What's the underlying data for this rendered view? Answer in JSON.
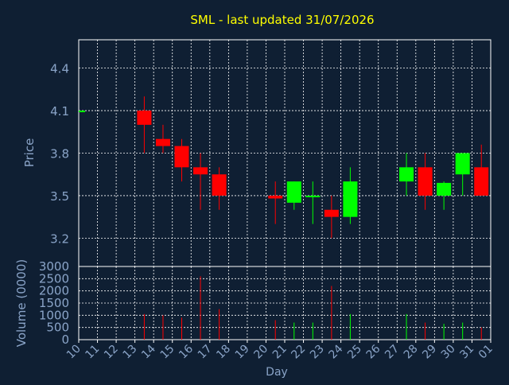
{
  "colors": {
    "background": "#0f1f33",
    "title": "#ffff00",
    "axis_text": "#8aa4c8",
    "grid": "#ffffff",
    "up": "#00ff00",
    "down": "#ff0000"
  },
  "chart_data": [
    {
      "type": "candlestick",
      "title": "SML - last updated 31/07/2026",
      "ylabel": "Price",
      "ylim": [
        3.0,
        4.6
      ],
      "yticks": [
        3.2,
        3.5,
        3.8,
        4.1,
        4.4
      ],
      "ytick_labels": [
        "3.2",
        "3.5",
        "3.8",
        "4.1",
        "4.4"
      ],
      "grid": true,
      "candles": [
        {
          "x": "10",
          "open": 4.1,
          "high": 4.1,
          "low": 4.1,
          "close": 4.1
        },
        {
          "x": "13",
          "open": 4.1,
          "high": 4.2,
          "low": 3.8,
          "close": 4.0
        },
        {
          "x": "14",
          "open": 3.9,
          "high": 4.0,
          "low": 3.8,
          "close": 3.85
        },
        {
          "x": "15",
          "open": 3.85,
          "high": 3.9,
          "low": 3.6,
          "close": 3.7
        },
        {
          "x": "16",
          "open": 3.7,
          "high": 3.8,
          "low": 3.4,
          "close": 3.65
        },
        {
          "x": "17",
          "open": 3.65,
          "high": 3.7,
          "low": 3.4,
          "close": 3.5
        },
        {
          "x": "20",
          "open": 3.5,
          "high": 3.6,
          "low": 3.3,
          "close": 3.48
        },
        {
          "x": "21",
          "open": 3.45,
          "high": 3.6,
          "low": 3.4,
          "close": 3.6
        },
        {
          "x": "22",
          "open": 3.49,
          "high": 3.6,
          "low": 3.3,
          "close": 3.5
        },
        {
          "x": "23",
          "open": 3.4,
          "high": 3.5,
          "low": 3.2,
          "close": 3.35
        },
        {
          "x": "24",
          "open": 3.35,
          "high": 3.7,
          "low": 3.3,
          "close": 3.6
        },
        {
          "x": "27",
          "open": 3.6,
          "high": 3.8,
          "low": 3.5,
          "close": 3.7
        },
        {
          "x": "28",
          "open": 3.7,
          "high": 3.8,
          "low": 3.4,
          "close": 3.5
        },
        {
          "x": "29",
          "open": 3.5,
          "high": 3.6,
          "low": 3.4,
          "close": 3.59
        },
        {
          "x": "30",
          "open": 3.65,
          "high": 3.8,
          "low": 3.5,
          "close": 3.8
        },
        {
          "x": "31",
          "open": 3.7,
          "high": 3.86,
          "low": 3.5,
          "close": 3.5
        }
      ]
    },
    {
      "type": "bar",
      "ylabel": "Volume (0000)",
      "xlabel": "Day",
      "ylim": [
        0,
        3000
      ],
      "yticks": [
        0,
        500,
        1000,
        1500,
        2000,
        2500,
        3000
      ],
      "ytick_labels": [
        "0",
        "500",
        "1000",
        "1500",
        "2000",
        "2500",
        "3000"
      ],
      "categories": [
        "10",
        "11",
        "12",
        "13",
        "14",
        "15",
        "16",
        "17",
        "18",
        "19",
        "20",
        "21",
        "22",
        "23",
        "24",
        "25",
        "26",
        "27",
        "28",
        "29",
        "30",
        "31",
        "01"
      ],
      "values": [
        0,
        0,
        0,
        1050,
        1000,
        900,
        2600,
        1250,
        0,
        0,
        800,
        700,
        700,
        2200,
        1050,
        0,
        0,
        1050,
        700,
        650,
        700,
        500,
        0
      ],
      "bar_colors": [
        "",
        "",
        "",
        "down",
        "down",
        "down",
        "down",
        "down",
        "",
        "",
        "down",
        "up",
        "up",
        "down",
        "up",
        "",
        "",
        "up",
        "down",
        "up",
        "up",
        "down",
        ""
      ],
      "grid": true
    }
  ]
}
